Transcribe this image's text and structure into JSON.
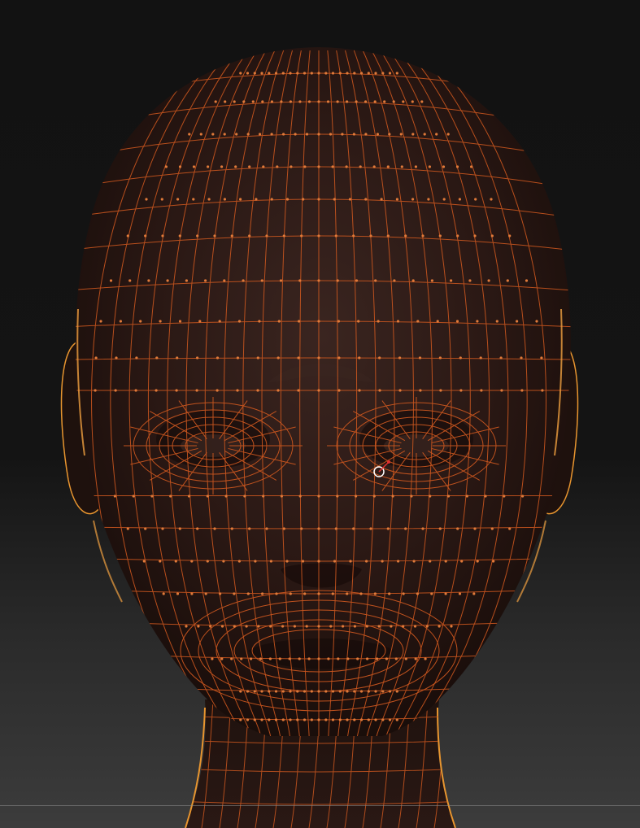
{
  "viewport": {
    "background_top": "#121212",
    "background_bottom": "#3c3c3c"
  },
  "model": {
    "surface_color": "#2a1814",
    "wireframe_color": "#c9561f",
    "rim_light_color": "#f0a040",
    "vertex_color": "#e07a3a"
  },
  "cursor": {
    "icon": "brush-cursor-icon",
    "ring_color": "#ffffff",
    "pointer_color": "#e03030"
  }
}
